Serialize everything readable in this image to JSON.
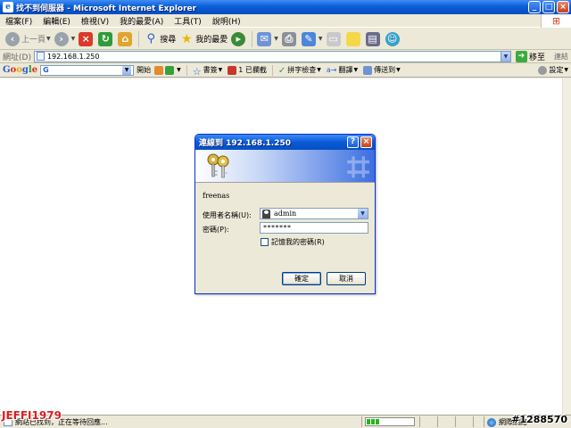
{
  "window": {
    "title": "找不到伺服器 - Microsoft Internet Explorer",
    "app_icon": "e",
    "buttons": {
      "minimize": "_",
      "maximize": "□",
      "close": "×"
    }
  },
  "menu": [
    "檔案(F)",
    "編輯(E)",
    "檢視(V)",
    "我的最愛(A)",
    "工具(T)",
    "說明(H)"
  ],
  "toolbar": {
    "back": "上一頁",
    "search": "搜尋",
    "favorites": "我的最愛"
  },
  "address": {
    "label": "網址(D)",
    "url": "192.168.1.250",
    "go": "移至",
    "links": "連結"
  },
  "google_bar": {
    "logo": "Google",
    "search_prefix": "G",
    "open": "開始",
    "bookmarks": "書簽",
    "blocked": "1 已攔截",
    "spellcheck": "拼字檢查",
    "translate": "翻譯",
    "send_to": "傳送到",
    "settings": "設定"
  },
  "dialog": {
    "title": "連線到 192.168.1.250",
    "help": "?",
    "close": "×",
    "realm": "freenas",
    "username_label": "使用者名稱(U):",
    "username_value": "admin",
    "password_label": "密碼(P):",
    "password_mask": "*******",
    "remember_label": "記憶我的密碼(R)",
    "remember_checked": false,
    "ok": "確定",
    "cancel": "取消"
  },
  "status": {
    "text": "網站已找到，正在等待回應...",
    "zone": "網際網路",
    "progress": 0.3
  },
  "watermarks": {
    "left": "JEFFI1979",
    "right": "#1288570"
  }
}
